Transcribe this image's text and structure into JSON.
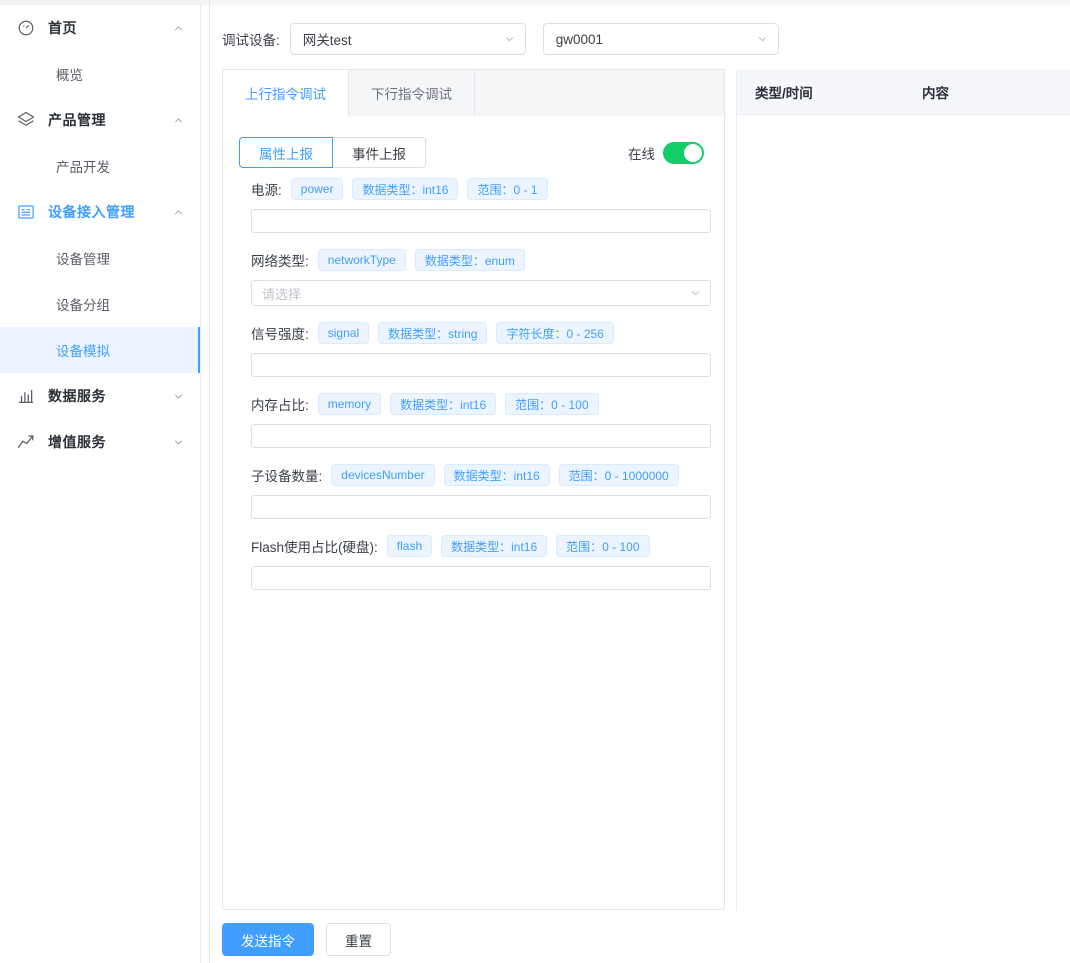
{
  "sidebar": {
    "groups": [
      {
        "icon": "dashboard-icon",
        "label": "首页",
        "arrow": "chevron-up",
        "active": false,
        "children": [
          {
            "label": "概览",
            "active": false
          }
        ]
      },
      {
        "icon": "layers-icon",
        "label": "产品管理",
        "arrow": "chevron-up",
        "active": false,
        "children": [
          {
            "label": "产品开发",
            "active": false
          }
        ]
      },
      {
        "icon": "device-list-icon",
        "label": "设备接入管理",
        "arrow": "chevron-up",
        "active": true,
        "children": [
          {
            "label": "设备管理",
            "active": false
          },
          {
            "label": "设备分组",
            "active": false
          },
          {
            "label": "设备模拟",
            "active": true
          }
        ]
      },
      {
        "icon": "bar-chart-icon",
        "label": "数据服务",
        "arrow": "chevron-down",
        "active": false,
        "children": []
      },
      {
        "icon": "trending-up-icon",
        "label": "增值服务",
        "arrow": "chevron-down",
        "active": false,
        "children": []
      }
    ]
  },
  "toolbar": {
    "label": "调试设备:",
    "device_select": {
      "value": "网关test"
    },
    "device_id_select": {
      "value": "gw0001"
    }
  },
  "tabs": [
    {
      "label": "上行指令调试",
      "active": true
    },
    {
      "label": "下行指令调试",
      "active": false
    }
  ],
  "sub_tabs": [
    {
      "label": "属性上报",
      "active": true
    },
    {
      "label": "事件上报",
      "active": false
    }
  ],
  "online": {
    "label": "在线",
    "on": true,
    "color": "#13ce66"
  },
  "fields": [
    {
      "name": "电源:",
      "key_tag": "power",
      "tags": [
        "数据类型：int16",
        "范围：0 - 1"
      ],
      "control": "input",
      "value": "",
      "placeholder": ""
    },
    {
      "name": "网络类型:",
      "key_tag": "networkType",
      "tags": [
        "数据类型：enum"
      ],
      "control": "select",
      "value": "",
      "placeholder": "请选择"
    },
    {
      "name": "信号强度:",
      "key_tag": "signal",
      "tags": [
        "数据类型：string",
        "字符长度：0 - 256"
      ],
      "control": "input",
      "value": "",
      "placeholder": ""
    },
    {
      "name": "内存占比:",
      "key_tag": "memory",
      "tags": [
        "数据类型：int16",
        "范围：0 - 100"
      ],
      "control": "input",
      "value": "",
      "placeholder": ""
    },
    {
      "name": "子设备数量:",
      "key_tag": "devicesNumber",
      "tags": [
        "数据类型：int16",
        "范围：0 - 1000000"
      ],
      "control": "input",
      "value": "",
      "placeholder": ""
    },
    {
      "name": "Flash使用占比(硬盘):",
      "key_tag": "flash",
      "tags": [
        "数据类型：int16",
        "范围：0 - 100"
      ],
      "control": "input",
      "value": "",
      "placeholder": ""
    }
  ],
  "footer": {
    "send_label": "发送指令",
    "reset_label": "重置"
  },
  "log_table": {
    "columns": [
      "类型/时间",
      "内容"
    ],
    "rows": []
  },
  "colors": {
    "accent": "#409eff",
    "tag_bg": "#ecf5ff",
    "switch_on": "#13ce66",
    "header_bg": "#f5f7fa"
  }
}
